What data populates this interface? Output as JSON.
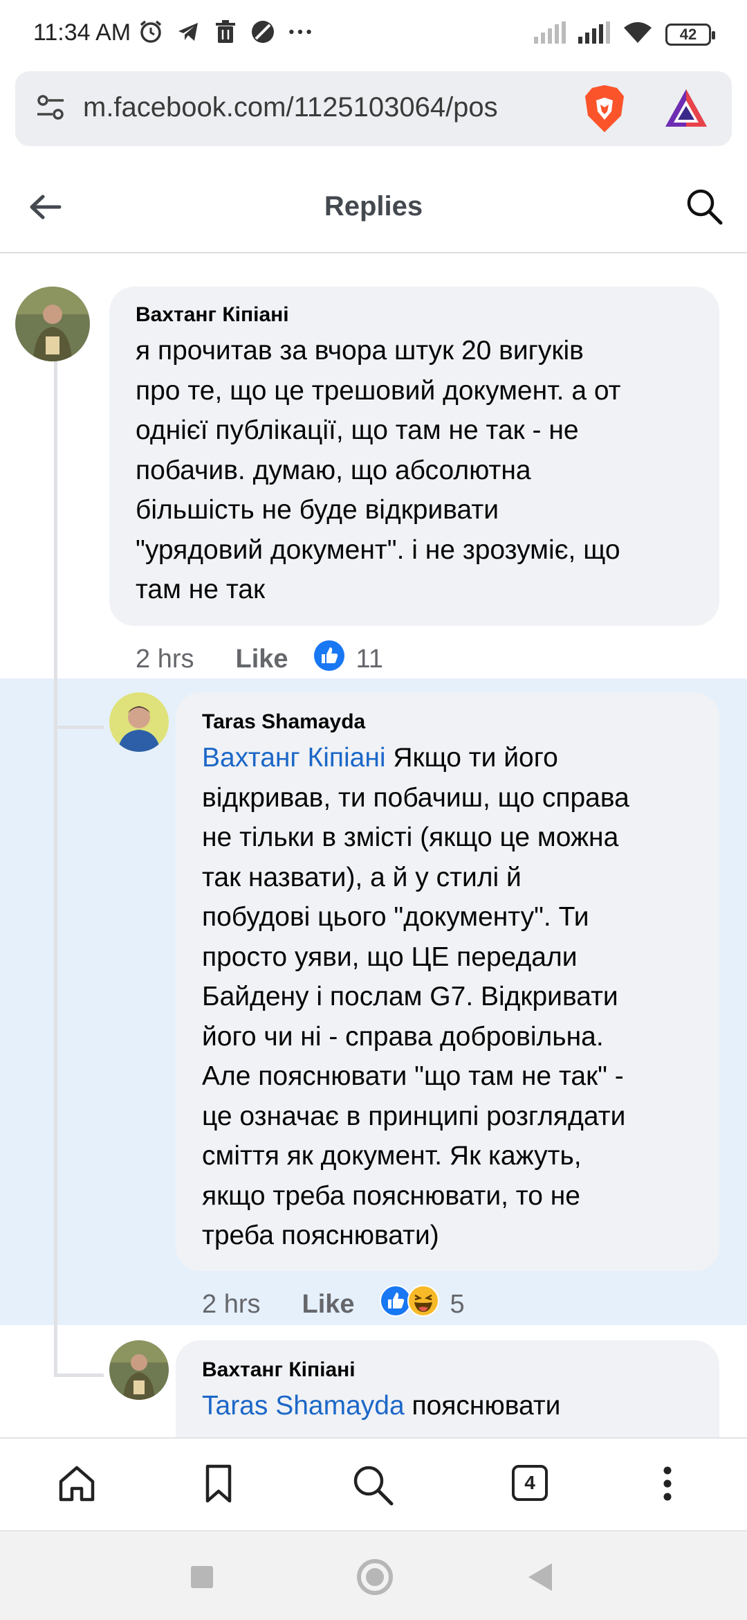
{
  "status_bar": {
    "time": "11:34 AM",
    "battery": "42",
    "left_icons": [
      "alarm-icon",
      "telegram-icon",
      "trash-icon",
      "vpn-icon",
      "more-icon"
    ],
    "right_icons": [
      "signal-weak-icon",
      "signal-icon",
      "wifi-icon",
      "battery-icon"
    ]
  },
  "browser": {
    "url": "m.facebook.com/1125103064/pos",
    "tab_count": "4"
  },
  "header": {
    "title": "Replies"
  },
  "comments": [
    {
      "author": "Вахтанг Кіпіані",
      "lines": [
        "я прочитав за вчора штук 20 вигуків",
        "про те, що це трешовий документ. а от",
        "однієї публікації, що там не так - не",
        "побачив. думаю, що абсолютна",
        "більшість не буде відкривати",
        "\"урядовий документ\". і не зрозуміє, що",
        "там не так"
      ],
      "time": "2 hrs",
      "like_label": "Like",
      "reaction_count": "11"
    },
    {
      "author": "Taras Shamayda",
      "mention": "Вахтанг Кіпіані",
      "first_line_rest": " Якщо ти його",
      "lines": [
        "відкривав, ти побачиш, що справа",
        "не тільки в змісті (якщо це можна",
        "так назвати), а й у стилі й",
        "побудові цього \"документу\". Ти",
        "просто уяви, що ЦЕ передали",
        "Байдену і послам G7. Відкривати",
        "його чи ні - справа добровільна.",
        "Але пояснювати \"що там не так\" -",
        "це означає в принципі розглядати",
        "сміття як документ. Як кажуть,",
        "якщо треба пояснювати, то не",
        "треба пояснювати)"
      ],
      "time": "2 hrs",
      "like_label": "Like",
      "reaction_count": "5"
    },
    {
      "author": "Вахтанг Кіпіані",
      "mention": "Taras Shamayda",
      "first_line_rest": " пояснювати"
    }
  ],
  "colors": {
    "mention": "#1c67c8",
    "bubble": "#f0f2f5",
    "highlight": "#e6f0fb",
    "like_blue": "#1877f2"
  }
}
